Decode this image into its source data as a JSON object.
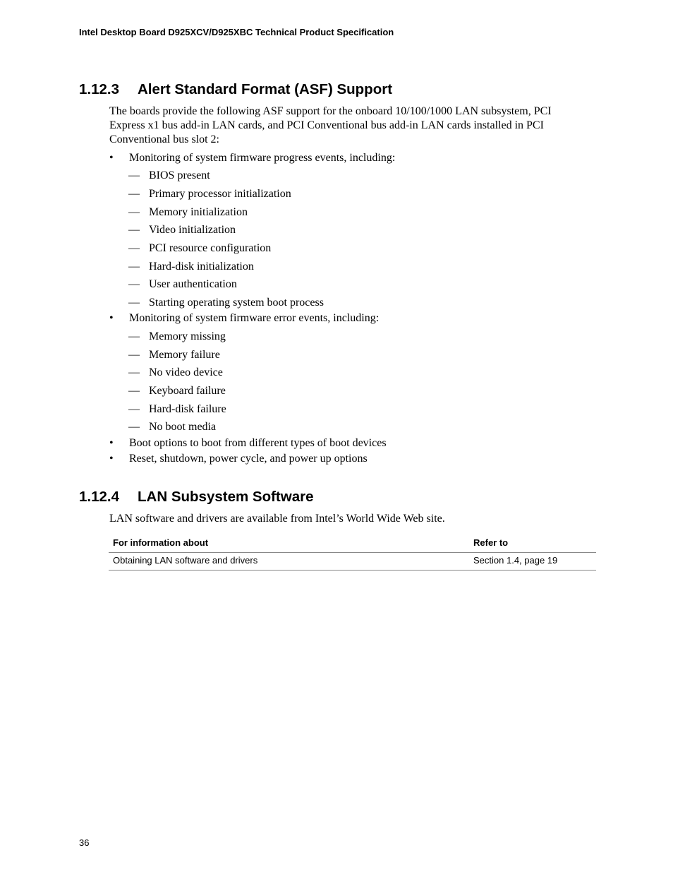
{
  "header": {
    "title": "Intel Desktop Board D925XCV/D925XBC Technical Product Specification"
  },
  "section_asf": {
    "number": "1.12.3",
    "title": "Alert Standard Format (ASF) Support",
    "intro_lines": [
      "The boards provide the following ASF support for the onboard 10/100/1000 LAN subsystem, PCI",
      "Express x1 bus add-in LAN cards, and PCI Conventional bus add-in LAN cards installed in PCI",
      "Conventional bus slot 2:"
    ],
    "bullet_glyph": "•",
    "dash_glyph": "—",
    "bullets": [
      {
        "text": "Monitoring of system firmware progress events, including:",
        "subitems": [
          "BIOS present",
          "Primary processor initialization",
          "Memory initialization",
          "Video initialization",
          "PCI resource configuration",
          "Hard-disk initialization",
          "User authentication",
          "Starting operating system boot process"
        ]
      },
      {
        "text": "Monitoring of system firmware error events, including:",
        "subitems": [
          "Memory missing",
          "Memory failure",
          "No video device",
          "Keyboard failure",
          "Hard-disk failure",
          "No boot media"
        ]
      },
      {
        "text": "Boot options to boot from different types of boot devices",
        "subitems": []
      },
      {
        "text": "Reset, shutdown, power cycle, and power up options",
        "subitems": []
      }
    ]
  },
  "section_lan": {
    "number": "1.12.4",
    "title": "LAN Subsystem Software",
    "intro": "LAN software and drivers are available from Intel’s World Wide Web site.",
    "table": {
      "headers": [
        "For information about",
        "Refer to"
      ],
      "rows": [
        [
          "Obtaining LAN software and drivers",
          "Section 1.4, page 19"
        ]
      ]
    }
  },
  "footer": {
    "page_number": "36"
  }
}
